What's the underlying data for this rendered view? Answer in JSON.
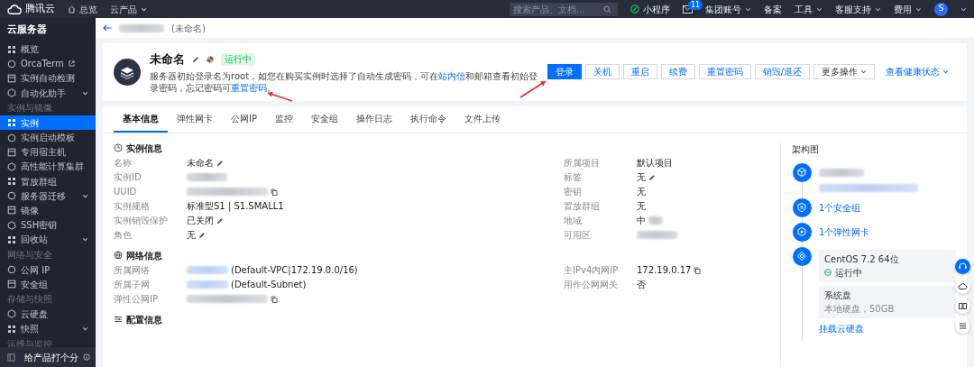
{
  "top_bar": {
    "brand": "腾讯云",
    "nav": [
      {
        "label": "总览",
        "kind": "home"
      },
      {
        "label": "云产品",
        "kind": "dropdown"
      }
    ],
    "search": {
      "placeholder": "搜索产品、文档..."
    },
    "items": [
      {
        "kind": "miniapp",
        "label": "小程序"
      },
      {
        "kind": "mail",
        "badge": "11"
      },
      {
        "kind": "dropdown",
        "label": "集团账号"
      },
      {
        "kind": "plain",
        "label": "备案"
      },
      {
        "kind": "dropdown",
        "label": "工具"
      },
      {
        "kind": "dropdown",
        "label": "客服支持"
      },
      {
        "kind": "dropdown",
        "label": "费用"
      },
      {
        "kind": "avatar",
        "initial": "S"
      }
    ]
  },
  "sidebar": {
    "title": "云服务器",
    "groups": [
      {
        "items": [
          {
            "label": "概览",
            "selected": false,
            "submenu": false,
            "external": false
          },
          {
            "label": "OrcaTerm",
            "selected": false,
            "submenu": false,
            "external": true
          },
          {
            "label": "实例自动检测",
            "selected": false,
            "submenu": false,
            "external": false
          },
          {
            "label": "自动化助手",
            "selected": false,
            "submenu": true,
            "external": false
          }
        ]
      },
      {
        "heading": "实例与镜像",
        "items": [
          {
            "label": "实例",
            "selected": true,
            "submenu": false,
            "external": false
          },
          {
            "label": "实例启动模板",
            "selected": false,
            "submenu": false,
            "external": false
          },
          {
            "label": "专用宿主机",
            "selected": false,
            "submenu": false,
            "external": false
          },
          {
            "label": "高性能计算集群",
            "selected": false,
            "submenu": false,
            "external": false
          },
          {
            "label": "置放群组",
            "selected": false,
            "submenu": false,
            "external": false
          },
          {
            "label": "服务器迁移",
            "selected": false,
            "submenu": true,
            "external": false
          },
          {
            "label": "镜像",
            "selected": false,
            "submenu": false,
            "external": false
          },
          {
            "label": "SSH密钥",
            "selected": false,
            "submenu": false,
            "external": false
          },
          {
            "label": "回收站",
            "selected": false,
            "submenu": true,
            "external": false
          }
        ]
      },
      {
        "heading": "网络与安全",
        "items": [
          {
            "label": "公网 IP",
            "selected": false,
            "submenu": false,
            "external": false
          },
          {
            "label": "安全组",
            "selected": false,
            "submenu": false,
            "external": false
          }
        ]
      },
      {
        "heading": "存储与快照",
        "items": [
          {
            "label": "云硬盘",
            "selected": false,
            "submenu": false,
            "external": false
          },
          {
            "label": "快照",
            "selected": false,
            "submenu": true,
            "external": false
          }
        ]
      },
      {
        "heading": "运维与监控"
      }
    ],
    "footer": "给产品打个分"
  },
  "breadcrumb": {
    "subtitle": "(未命名)"
  },
  "header": {
    "title": "未命名",
    "status": "运行中",
    "description": [
      {
        "kind": "text",
        "text": "服务器初始登录名为root，如您在购买实例时选择了自动生成密码，可在"
      },
      {
        "kind": "link",
        "text": "站内信"
      },
      {
        "kind": "text",
        "text": "和邮箱查看初始登录密码，忘记密码可"
      },
      {
        "kind": "link",
        "text": "重置密码"
      },
      {
        "kind": "text",
        "text": "。"
      }
    ],
    "buttons": [
      {
        "label": "登录",
        "kind": "primary"
      },
      {
        "label": "关机",
        "kind": "default"
      },
      {
        "label": "重启",
        "kind": "default"
      },
      {
        "label": "续费",
        "kind": "default"
      },
      {
        "label": "重置密码",
        "kind": "default"
      },
      {
        "label": "销毁/退还",
        "kind": "default"
      },
      {
        "label": "更多操作",
        "kind": "dropdown"
      },
      {
        "label": "查看健康状态",
        "kind": "link"
      }
    ]
  },
  "tabs": [
    {
      "label": "基本信息",
      "selected": true
    },
    {
      "label": "弹性网卡",
      "selected": false
    },
    {
      "label": "公网IP",
      "selected": false
    },
    {
      "label": "监控",
      "selected": false
    },
    {
      "label": "安全组",
      "selected": false
    },
    {
      "label": "操作日志",
      "selected": false
    },
    {
      "label": "执行命令",
      "selected": false
    },
    {
      "label": "文件上传",
      "selected": false
    }
  ],
  "sections": [
    {
      "title": "实例信息",
      "left": [
        {
          "label": "名称",
          "parts": [
            {
              "kind": "text",
              "text": "未命名"
            }
          ],
          "editable": true,
          "copyable": false
        },
        {
          "label": "实例ID",
          "parts": [
            {
              "kind": "redacted"
            }
          ],
          "editable": false,
          "copyable": false
        },
        {
          "label": "UUID",
          "parts": [
            {
              "kind": "redacted"
            }
          ],
          "editable": false,
          "copyable": true
        },
        {
          "label": "实例规格",
          "parts": [
            {
              "kind": "text",
              "text": "标准型S1 | S1.SMALL1"
            }
          ],
          "editable": false,
          "copyable": false
        },
        {
          "label": "实例销毁保护",
          "parts": [
            {
              "kind": "text",
              "text": "已关闭"
            }
          ],
          "editable": true,
          "copyable": false
        },
        {
          "label": "角色",
          "parts": [
            {
              "kind": "text",
              "text": "无"
            }
          ],
          "editable": true,
          "copyable": false
        }
      ],
      "right": [
        {
          "label": "所属项目",
          "parts": [
            {
              "kind": "text",
              "text": "默认项目"
            }
          ],
          "editable": false,
          "copyable": false
        },
        {
          "label": "标签",
          "parts": [
            {
              "kind": "text",
              "text": "无"
            }
          ],
          "editable": true,
          "copyable": false
        },
        {
          "label": "密钥",
          "parts": [
            {
              "kind": "text",
              "text": "无"
            }
          ],
          "editable": false,
          "copyable": false
        },
        {
          "label": "置放群组",
          "parts": [
            {
              "kind": "text",
              "text": "无"
            }
          ],
          "editable": false,
          "copyable": false
        },
        {
          "label": "地域",
          "parts": [
            {
              "kind": "text",
              "text": "中"
            },
            {
              "kind": "redacted"
            }
          ],
          "editable": false,
          "copyable": false
        },
        {
          "label": "可用区",
          "parts": [
            {
              "kind": "redacted"
            }
          ],
          "editable": false,
          "copyable": false
        }
      ]
    },
    {
      "title": "网络信息",
      "left": [
        {
          "label": "所属网络",
          "parts": [
            {
              "kind": "redacted"
            },
            {
              "kind": "text",
              "text": "(Default-VPC|172.19.0.0/16)"
            }
          ],
          "editable": false,
          "copyable": false
        },
        {
          "label": "所属子网",
          "parts": [
            {
              "kind": "redacted"
            },
            {
              "kind": "text",
              "text": "(Default-Subnet)"
            }
          ],
          "editable": false,
          "copyable": false
        },
        {
          "label": "弹性公网IP",
          "parts": [
            {
              "kind": "redacted"
            }
          ],
          "editable": false,
          "copyable": true
        }
      ],
      "right": [
        {
          "label": "主IPv4内网IP",
          "parts": [
            {
              "kind": "text",
              "text": "172.19.0.17"
            }
          ],
          "editable": false,
          "copyable": true
        },
        {
          "label": "用作公网网关",
          "parts": [
            {
              "kind": "text",
              "text": "否"
            }
          ],
          "editable": false,
          "copyable": false
        }
      ]
    },
    {
      "title": "配置信息"
    }
  ],
  "architecture": {
    "title": "架构图",
    "nodes": [
      {
        "kind": "blurred"
      },
      {
        "kind": "link",
        "label": "1个安全组"
      },
      {
        "kind": "link",
        "label": "1个弹性网卡"
      },
      {
        "kind": "os",
        "title": "CentOS 7.2 64位",
        "status": "运行中",
        "children": [
          {
            "kind": "disk",
            "title": "系统盘",
            "detail": "本地硬盘，50GB"
          },
          {
            "kind": "link",
            "label": "挂载云硬盘"
          }
        ]
      }
    ]
  }
}
